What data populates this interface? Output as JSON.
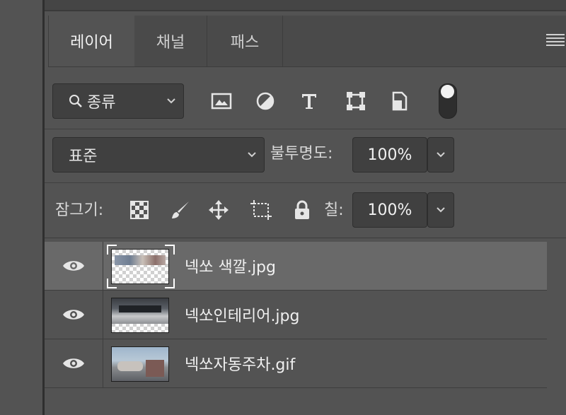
{
  "tabs": [
    {
      "label": "레이어"
    },
    {
      "label": "채널"
    },
    {
      "label": "패스"
    }
  ],
  "filter": {
    "kind_label": "종류",
    "icons": [
      "image-filter-icon",
      "adjustment-filter-icon",
      "type-filter-icon",
      "shape-filter-icon",
      "smart-object-filter-icon"
    ],
    "toggle_on": true
  },
  "blend": {
    "mode": "표준",
    "opacity_label": "불투명도:",
    "opacity_value": "100%"
  },
  "lock": {
    "label": "잠그기:",
    "icons": [
      "lock-transparent-pixels-icon",
      "lock-image-pixels-icon",
      "lock-position-icon",
      "lock-artboard-icon",
      "lock-all-icon"
    ],
    "fill_label": "칠:",
    "fill_value": "100%"
  },
  "layers": [
    {
      "name": "넥쏘 색깔.jpg",
      "visible": true,
      "selected": true
    },
    {
      "name": "넥쏘인테리어.jpg",
      "visible": true,
      "selected": false
    },
    {
      "name": "넥쏘자동주차.gif",
      "visible": true,
      "selected": false
    }
  ],
  "colors": {
    "panel_bg": "#535353",
    "selected_row": "#696969",
    "field_bg": "#404040"
  }
}
